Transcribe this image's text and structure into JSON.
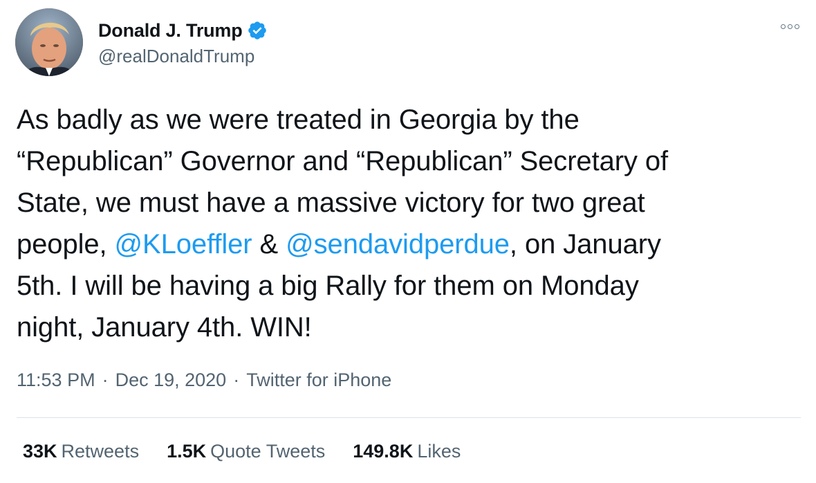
{
  "author": {
    "display_name": "Donald J. Trump",
    "handle": "@realDonaldTrump",
    "verified": true
  },
  "tweet": {
    "lines": [
      {
        "parts": [
          {
            "text": "As badly as we were treated in Georgia by the",
            "type": "text"
          }
        ]
      },
      {
        "parts": [
          {
            "text": "“Republican” Governor and “Republican” Secretary of",
            "type": "text"
          }
        ]
      },
      {
        "parts": [
          {
            "text": "State, we must have a massive victory for two great",
            "type": "text"
          }
        ]
      },
      {
        "parts": [
          {
            "text": "people, ",
            "type": "text"
          },
          {
            "text": "@KLoeffler",
            "type": "mention"
          },
          {
            "text": " & ",
            "type": "text"
          },
          {
            "text": "@sendavidperdue",
            "type": "mention"
          },
          {
            "text": ", on January",
            "type": "text"
          }
        ]
      },
      {
        "parts": [
          {
            "text": "5th. I will be having a big Rally for them on Monday",
            "type": "text"
          }
        ]
      },
      {
        "parts": [
          {
            "text": "night, January 4th. WIN!",
            "type": "text"
          }
        ]
      }
    ]
  },
  "meta": {
    "time": "11:53 PM",
    "separator": "·",
    "date": "Dec 19, 2020",
    "source": "Twitter for iPhone"
  },
  "stats": {
    "retweets": {
      "count": "33K",
      "label": "Retweets"
    },
    "quote_tweets": {
      "count": "1.5K",
      "label": "Quote Tweets"
    },
    "likes": {
      "count": "149.8K",
      "label": "Likes"
    }
  },
  "icons": {
    "verified": "verified-badge-icon",
    "more": "more-options-icon",
    "avatar": "profile-avatar"
  },
  "colors": {
    "text": "#0f1419",
    "secondary": "#536471",
    "link": "#1d9bf0",
    "verified": "#1d9bf0"
  }
}
